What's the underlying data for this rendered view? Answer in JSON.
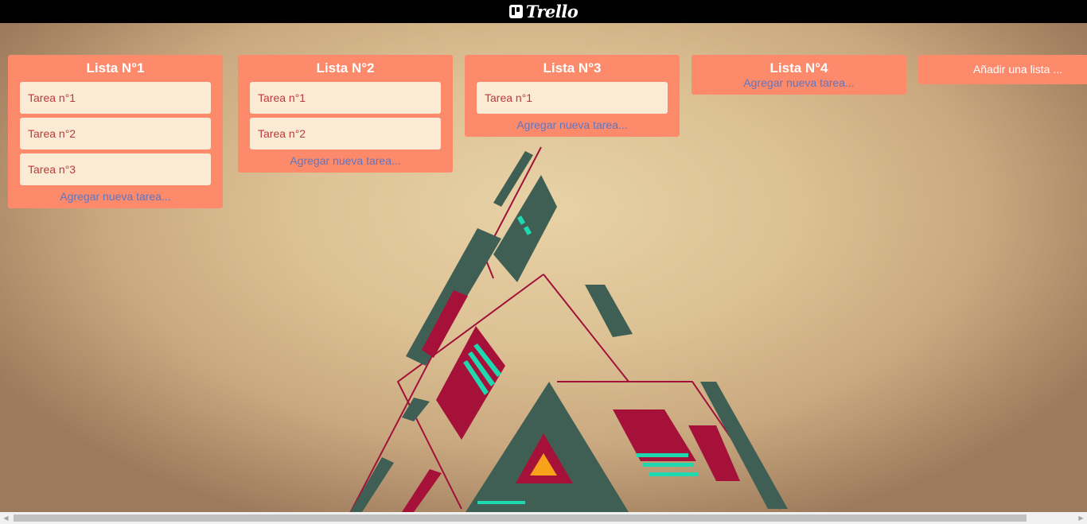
{
  "header": {
    "logo_text": "Trello",
    "logo_icon": "trello-board-icon"
  },
  "lists": [
    {
      "title": "Lista N°1",
      "cards": [
        "Tarea n°1",
        "Tarea n°2",
        "Tarea n°3"
      ],
      "add_label": "Agregar nueva tarea..."
    },
    {
      "title": "Lista N°2",
      "cards": [
        "Tarea n°1",
        "Tarea n°2"
      ],
      "add_label": "Agregar nueva tarea..."
    },
    {
      "title": "Lista N°3",
      "cards": [
        "Tarea n°1"
      ],
      "add_label": "Agregar nueva tarea..."
    },
    {
      "title": "Lista N°4",
      "cards": [],
      "add_label": "Agregar nueva tarea..."
    }
  ],
  "add_list_label": "Añadir una lista ...",
  "colors": {
    "list_bg": "#fe8a6c",
    "card_bg": "#fbead4",
    "card_text": "#bb3a3a",
    "add_link": "#5f76c0",
    "header_bg": "#000000"
  },
  "scrollbar": {
    "left_icon": "arrow-left-icon",
    "right_icon": "arrow-right-icon"
  }
}
